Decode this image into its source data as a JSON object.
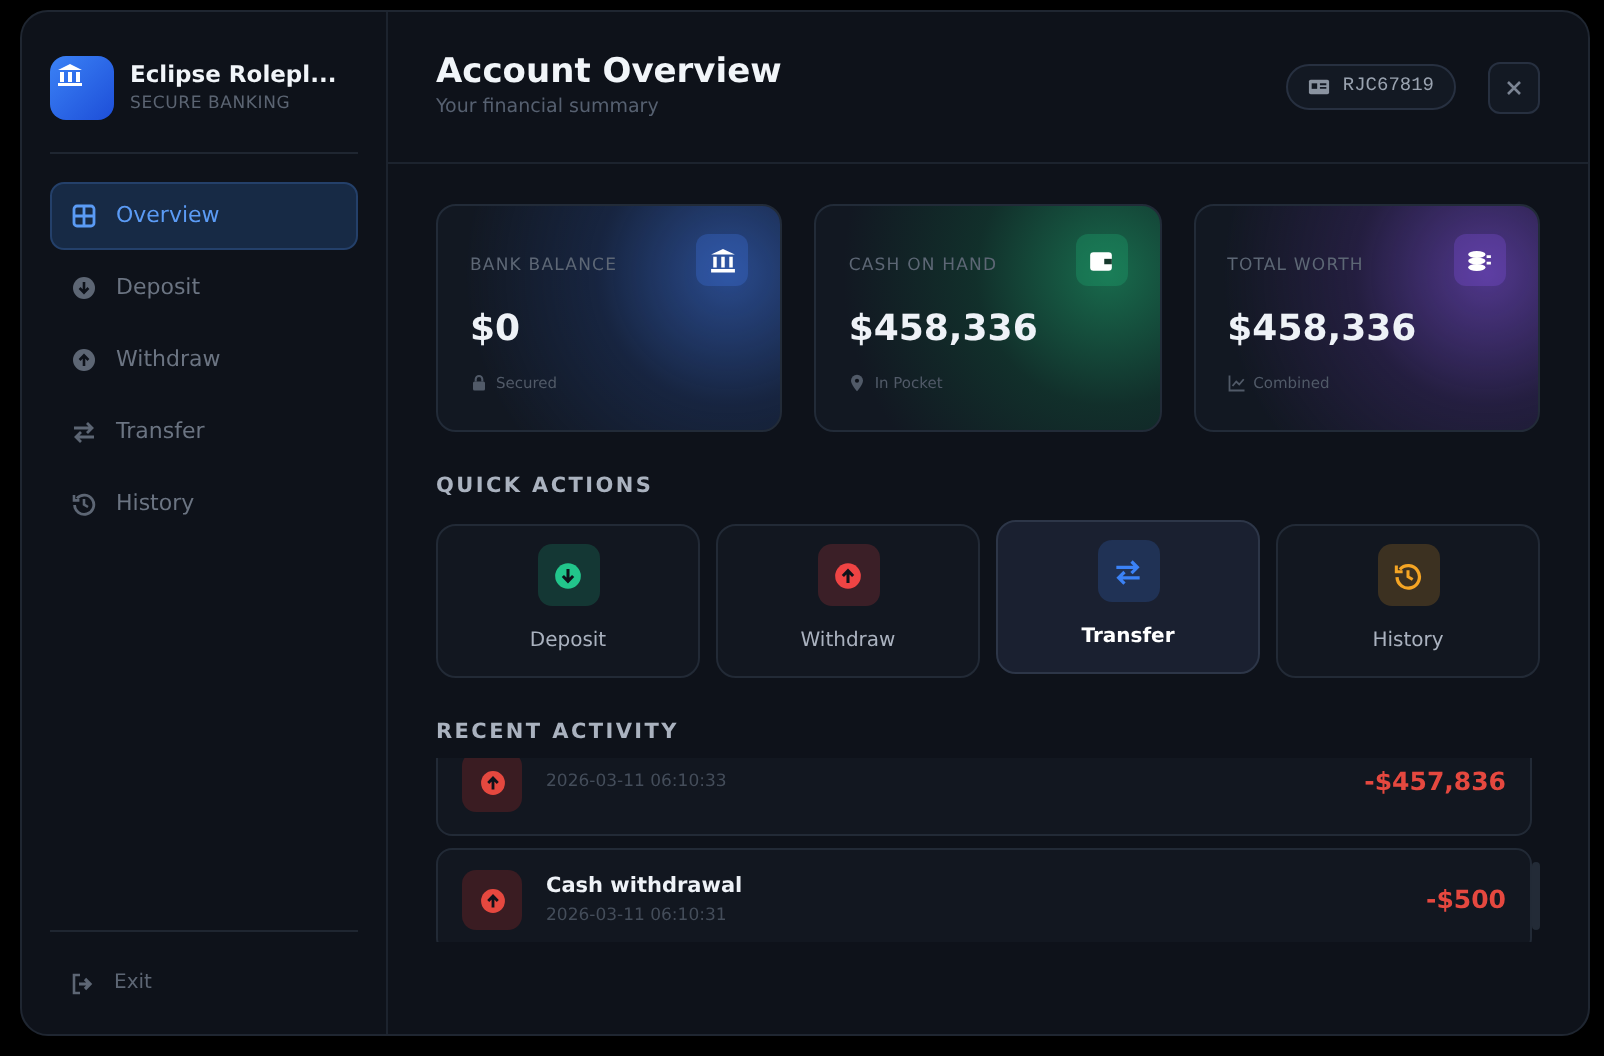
{
  "brand": {
    "name": "Eclipse Rolepl...",
    "tagline": "SECURE BANKING"
  },
  "nav": [
    {
      "label": "Overview",
      "kind": "overview",
      "selected": true
    },
    {
      "label": "Deposit",
      "kind": "deposit",
      "selected": false
    },
    {
      "label": "Withdraw",
      "kind": "withdraw",
      "selected": false
    },
    {
      "label": "Transfer",
      "kind": "transfer",
      "selected": false
    },
    {
      "label": "History",
      "kind": "history",
      "selected": false
    }
  ],
  "exit": {
    "label": "Exit"
  },
  "header": {
    "title": "Account Overview",
    "subtitle": "Your financial summary",
    "account_id": "RJC67819"
  },
  "stats": [
    {
      "label": "BANK BALANCE",
      "value": "$0",
      "note": "Secured",
      "kind": "bank"
    },
    {
      "label": "CASH ON HAND",
      "value": "$458,336",
      "note": "In Pocket",
      "kind": "cash"
    },
    {
      "label": "TOTAL WORTH",
      "value": "$458,336",
      "note": "Combined",
      "kind": "total"
    }
  ],
  "quick_actions": {
    "title": "QUICK ACTIONS",
    "items": [
      {
        "label": "Deposit",
        "kind": "deposit",
        "selected": false
      },
      {
        "label": "Withdraw",
        "kind": "withdraw",
        "selected": false
      },
      {
        "label": "Transfer",
        "kind": "transfer",
        "selected": true
      },
      {
        "label": "History",
        "kind": "history",
        "selected": false
      }
    ]
  },
  "recent_activity": {
    "title": "RECENT ACTIVITY",
    "items": [
      {
        "kind": "withdrawal",
        "date": "2026-03-11 06:10:33",
        "amount": "-$457,836"
      },
      {
        "kind": "withdrawal",
        "title": "Cash withdrawal",
        "date": "2026-03-11 06:10:31",
        "amount": "-$500"
      }
    ]
  }
}
